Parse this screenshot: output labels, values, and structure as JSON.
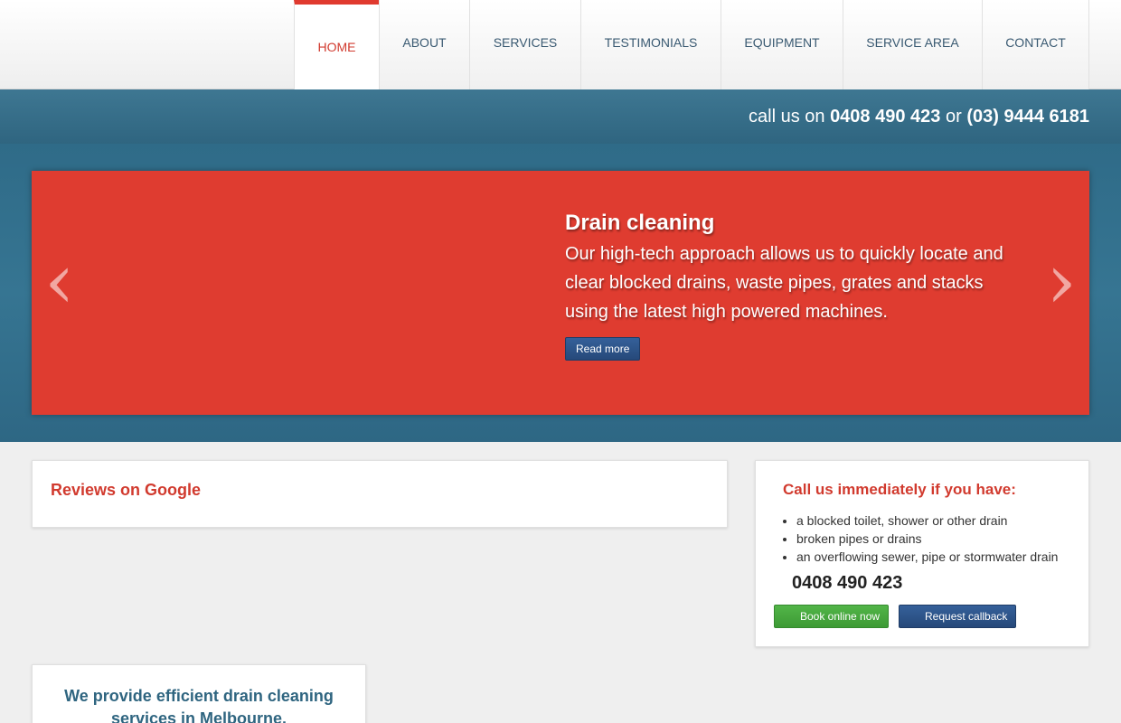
{
  "nav": {
    "items": [
      {
        "label": "HOME",
        "active": true
      },
      {
        "label": "ABOUT"
      },
      {
        "label": "SERVICES"
      },
      {
        "label": "TESTIMONIALS"
      },
      {
        "label": "EQUIPMENT"
      },
      {
        "label": "SERVICE AREA"
      },
      {
        "label": "CONTACT"
      }
    ]
  },
  "callbar": {
    "prefix": "call us on",
    "phone1": "0408 490 423",
    "or": "or",
    "phone2": "(03) 9444 6181"
  },
  "slider": {
    "prev_glyph": "‹",
    "next_glyph": "›",
    "title": "Drain cleaning",
    "body": "Our high-tech approach allows us to quickly locate and clear blocked drains, waste pipes, grates and stacks using the latest high powered machines.",
    "button": "Read more"
  },
  "reviews": {
    "title": "Reviews on Google"
  },
  "callnow": {
    "title": "Call us immediately if you have:",
    "items": [
      "a blocked toilet, shower or other drain",
      "broken pipes or drains",
      "an overflowing sewer, pipe or stormwater drain"
    ],
    "phone": "0408 490 423",
    "book_button": "Book online now",
    "callback_button": "Request callback"
  },
  "efficient": {
    "title": "We provide efficient drain cleaning services in Melbourne."
  },
  "colors": {
    "accent_red": "#df3c30",
    "teal": "#2f6580",
    "green": "#52b548",
    "navy": "#26497a"
  }
}
